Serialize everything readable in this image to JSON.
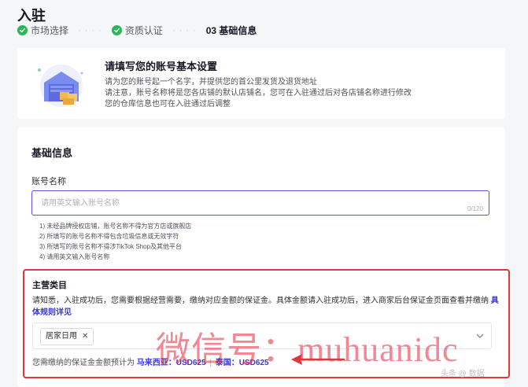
{
  "page": {
    "title": "入驻"
  },
  "steps": [
    {
      "label": "市场选择",
      "status": "done"
    },
    {
      "label": "资质认证",
      "status": "done"
    },
    {
      "label": "03 基础信息",
      "status": "current"
    }
  ],
  "step_separator": "· · · ·",
  "intro": {
    "title": "请填写您的账号基本设置",
    "lines": [
      "请为您的账号起一个名字，并提供您的首公里发货及退货地址",
      "请注意，账号名称将是您各店铺的默认店铺名，您可在入驻通过后对各店铺名称进行修改",
      "您的仓库信息也可在入驻通过后调整"
    ]
  },
  "form": {
    "section_title": "基础信息",
    "account_name": {
      "label": "账号名称",
      "placeholder": "请用英文输入账号名称",
      "value": "",
      "counter": "0/120"
    },
    "rules": [
      "1) 未经品牌授权店铺，账号名称不得为官方店或旗舰店",
      "2) 所填写的账号名称不得包含垃圾信息或无效字符",
      "3) 所填写的账号名称不得涉TikTok Shop及其他平台",
      "4) 请用英文输入账号名称"
    ],
    "category": {
      "label": "主营类目",
      "notice": "请知悉，入驻成功后，您需要根据经营需要，缴纳对应金额的保证金。具体金额请入驻成功后，进入商家后台保证金页面查看并缴纳",
      "link": "具体规则详见",
      "selected_tag": "居家日用",
      "tag_remove": "✕",
      "deposit_prefix": "您需缴纳的保证金金额预计为",
      "deposit_malaysia": "马来西亚：USD625",
      "deposit_separator": "|",
      "deposit_thailand": "泰国：USD625"
    }
  },
  "overlay": {
    "watermark": "微信号：muhuanidc",
    "corner_mark": "头条 @ 数据",
    "color": "#e0373e"
  },
  "colors": {
    "accent": "#5b4ee0",
    "link": "#3a37d6",
    "success": "#2fb35b",
    "highlight_border": "#e0373e"
  }
}
